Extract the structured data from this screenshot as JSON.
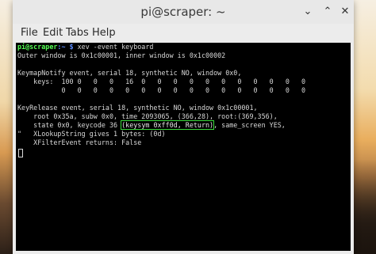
{
  "window": {
    "title": "pi@scraper: ~",
    "minimize_glyph": "⌄",
    "maximize_glyph": "⌃",
    "close_glyph": "✕"
  },
  "menu": {
    "items": [
      {
        "label": "File"
      },
      {
        "label": "Edit"
      },
      {
        "label": "Tabs"
      },
      {
        "label": "Help"
      }
    ]
  },
  "terminal": {
    "prompt_user": "pi@scraper",
    "prompt_path": ":~ $",
    "command": " xev -event keyboard",
    "lines": {
      "l1": "Outer window is 0x1c00001, inner window is 0x1c00002",
      "l3": "KeymapNotify event, serial 18, synthetic NO, window 0x0,",
      "l4": "    keys:  100 0   0   0   16  0   0   0   0   0   0   0   0   0   0   0",
      "l5": "           0   0   0   0   0   0   0   0   0   0   0   0   0   0   0   0",
      "l7": "KeyRelease event, serial 18, synthetic NO, window 0x1c00001,",
      "l8": "    root 0x35a, subw 0x0, time 2093065, (366,28), root:(369,356),",
      "l9_pre": "    state 0x0, keycode 36 ",
      "l9_hl": "(keysym 0xff0d, Return)",
      "l9_post": ", same_screen YES,",
      "l10": "\"   XLookupString gives 1 bytes: (0d)",
      "l11": "    XFilterEvent returns: False"
    }
  },
  "colors": {
    "prompt_user": "#55ff55",
    "prompt_path": "#5c8cff",
    "highlight_box": "#3bdc3b",
    "terminal_bg": "#000000"
  }
}
